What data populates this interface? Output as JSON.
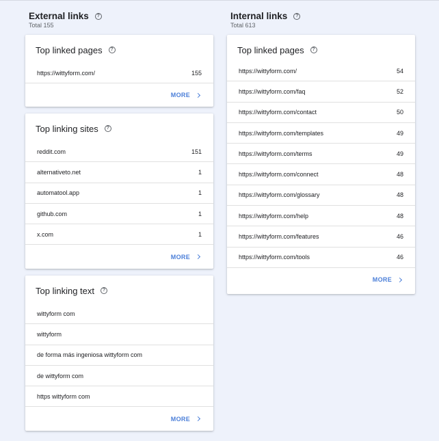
{
  "external": {
    "title": "External links",
    "total": "Total 155",
    "top_linked_pages": {
      "title": "Top linked pages",
      "rows": [
        {
          "label": "https://wittyform.com/",
          "value": "155"
        }
      ],
      "more": "MORE"
    },
    "top_linking_sites": {
      "title": "Top linking sites",
      "rows": [
        {
          "label": "reddit.com",
          "value": "151"
        },
        {
          "label": "alternativeto.net",
          "value": "1"
        },
        {
          "label": "automatool.app",
          "value": "1"
        },
        {
          "label": "github.com",
          "value": "1"
        },
        {
          "label": "x.com",
          "value": "1"
        }
      ],
      "more": "MORE"
    },
    "top_linking_text": {
      "title": "Top linking text",
      "rows": [
        {
          "label": "wittyform com"
        },
        {
          "label": "wittyform"
        },
        {
          "label": "de forma más ingeniosa wittyform com"
        },
        {
          "label": "de wittyform com"
        },
        {
          "label": "https wittyform com"
        }
      ],
      "more": "MORE"
    }
  },
  "internal": {
    "title": "Internal links",
    "total": "Total 613",
    "top_linked_pages": {
      "title": "Top linked pages",
      "rows": [
        {
          "label": "https://wittyform.com/",
          "value": "54"
        },
        {
          "label": "https://wittyform.com/faq",
          "value": "52"
        },
        {
          "label": "https://wittyform.com/contact",
          "value": "50"
        },
        {
          "label": "https://wittyform.com/templates",
          "value": "49"
        },
        {
          "label": "https://wittyform.com/terms",
          "value": "49"
        },
        {
          "label": "https://wittyform.com/connect",
          "value": "48"
        },
        {
          "label": "https://wittyform.com/glossary",
          "value": "48"
        },
        {
          "label": "https://wittyform.com/help",
          "value": "48"
        },
        {
          "label": "https://wittyform.com/features",
          "value": "46"
        },
        {
          "label": "https://wittyform.com/tools",
          "value": "46"
        }
      ],
      "more": "MORE"
    }
  }
}
